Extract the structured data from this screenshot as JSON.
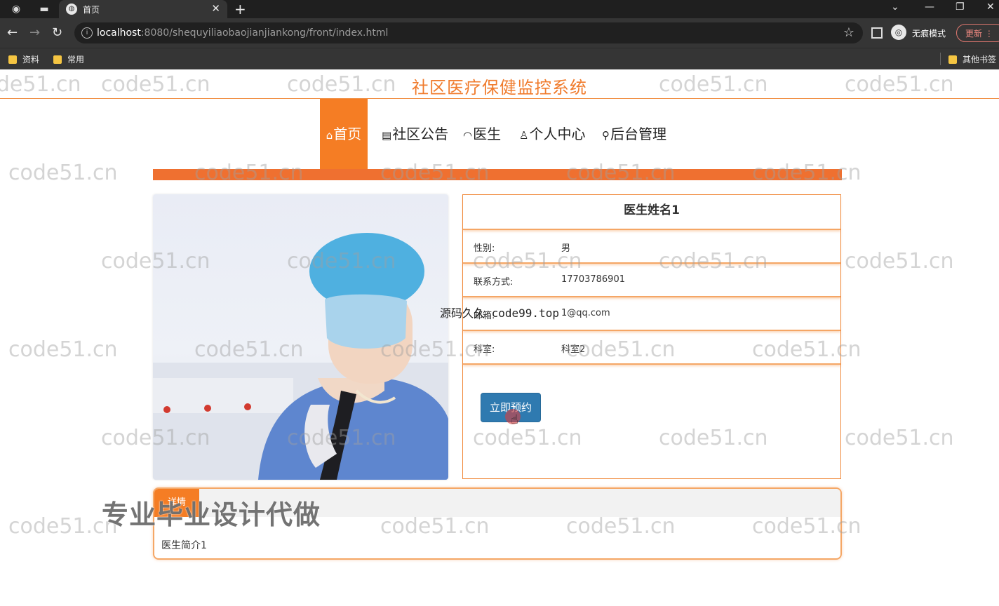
{
  "browser": {
    "tab_title": "首页",
    "url_host": "localhost",
    "url_rest": ":8080/shequyiliaobaojianjiankong/front/index.html",
    "incognito_label": "无痕模式",
    "update_label": "更新",
    "bookmarks": [
      "资料",
      "常用"
    ],
    "other_bookmarks": "其他书签"
  },
  "site": {
    "title": "社区医疗保健监控系统",
    "nav": [
      {
        "icon": "home-icon",
        "glyph": "⌂",
        "label": "首页"
      },
      {
        "icon": "notice-icon",
        "glyph": "▤",
        "label": "社区公告"
      },
      {
        "icon": "dashboard-icon",
        "glyph": "◠",
        "label": "医生"
      },
      {
        "icon": "user-icon",
        "glyph": "♙",
        "label": "个人中心"
      },
      {
        "icon": "link-icon",
        "glyph": "⚲",
        "label": "后台管理"
      }
    ]
  },
  "doctor": {
    "name": "医生姓名1",
    "rows": [
      {
        "label": "性别:",
        "value": "男"
      },
      {
        "label": "联系方式:",
        "value": "17703786901"
      },
      {
        "label": "邮箱:",
        "value": "1@qq.com"
      },
      {
        "label": "科室:",
        "value": "科室2"
      }
    ],
    "book_label": "立即预约"
  },
  "detail": {
    "tab_label": "详情",
    "text": "医生简介1"
  },
  "watermarks": {
    "site": "code51.cn",
    "overlay": "源码久久-code99.top",
    "promo": "专业毕业设计代做"
  },
  "colors": {
    "accent": "#f57d24",
    "bar": "#ef7030",
    "button": "#2f7ab0"
  }
}
